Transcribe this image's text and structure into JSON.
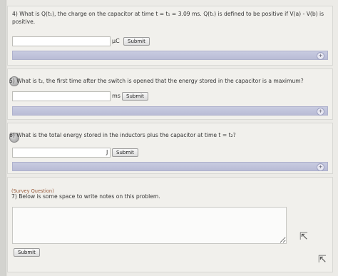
{
  "q4": {
    "text_line1": "4) What is Q(t₁), the charge on the capacitor at time t = t₁ = 3.09 ms. Q(t₁) is defined to be positive if V(a) - V(b) is",
    "text_line2": "positive.",
    "input_value": "",
    "unit": "μC",
    "submit_label": "Submit",
    "hint_icon": "plus-icon"
  },
  "q5": {
    "text": "5) What is t₂, the first time after the switch is opened that the energy stored in the capacitor is a maximum?",
    "input_value": "",
    "unit": "ms",
    "submit_label": "Submit",
    "hint_icon": "plus-icon"
  },
  "q6": {
    "text": "6) What is the total energy stored in the inductors plus the capacitor at time t = t₂?",
    "input_value": "",
    "unit": "J",
    "submit_label": "Submit",
    "hint_icon": "plus-icon"
  },
  "q7": {
    "tag": "(Survey Question)",
    "text": "7) Below is some space to write notes on this problem.",
    "notes_value": "",
    "submit_label": "Submit"
  }
}
